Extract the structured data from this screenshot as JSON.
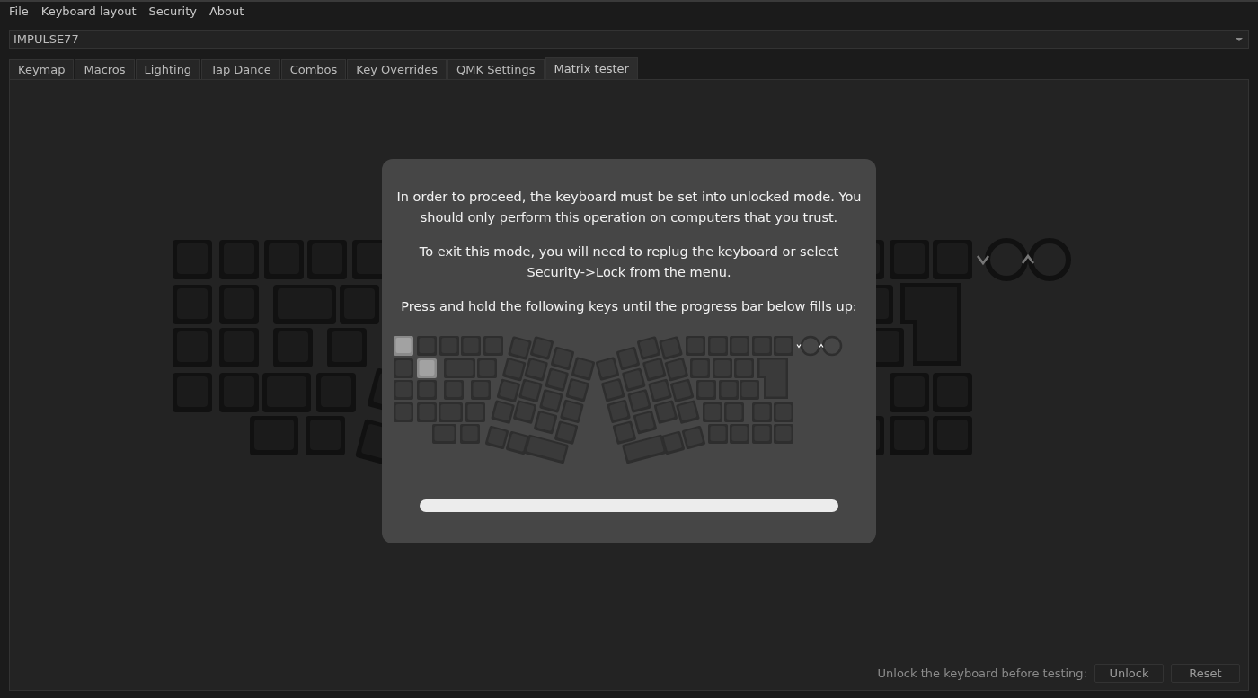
{
  "menu": [
    "File",
    "Keyboard layout",
    "Security",
    "About"
  ],
  "device_select": {
    "value": "IMPULSE77"
  },
  "tabs": [
    {
      "label": "Keymap",
      "selected": false
    },
    {
      "label": "Macros",
      "selected": false
    },
    {
      "label": "Lighting",
      "selected": false
    },
    {
      "label": "Tap Dance",
      "selected": false
    },
    {
      "label": "Combos",
      "selected": false
    },
    {
      "label": "Key Overrides",
      "selected": false
    },
    {
      "label": "QMK Settings",
      "selected": false
    },
    {
      "label": "Matrix tester",
      "selected": true
    }
  ],
  "dialog": {
    "paragraphs": [
      "In order to proceed, the keyboard must be set into unlocked mode. You should only perform this operation on computers that you trust.",
      "To exit this mode, you will need to replug the keyboard or select Security->Lock from the menu.",
      "Press and hold the following keys until the progress bar below fills up:"
    ],
    "keyboard": {
      "keys": [
        {
          "highlighted": true
        },
        {
          "highlighted": false
        },
        {
          "highlighted": false
        },
        {
          "highlighted": false
        },
        {
          "highlighted": false
        },
        {
          "highlighted": false
        },
        {
          "highlighted": true
        },
        {
          "highlighted": false
        },
        {
          "highlighted": false
        },
        {
          "highlighted": false
        },
        {
          "highlighted": false
        },
        {
          "highlighted": false
        },
        {
          "highlighted": false
        },
        {
          "highlighted": false
        },
        {
          "highlighted": false
        },
        {
          "highlighted": false
        },
        {
          "highlighted": false
        },
        {
          "highlighted": false
        },
        {
          "highlighted": false
        },
        {
          "highlighted": false
        },
        {
          "highlighted": false
        },
        {
          "highlighted": false
        },
        {
          "highlighted": false
        },
        {
          "highlighted": false
        },
        {
          "highlighted": false
        },
        {
          "highlighted": false
        },
        {
          "highlighted": false
        },
        {
          "highlighted": false
        },
        {
          "highlighted": false
        },
        {
          "highlighted": false
        },
        {
          "highlighted": false
        },
        {
          "highlighted": false
        },
        {
          "highlighted": false
        },
        {
          "highlighted": false
        },
        {
          "highlighted": false
        },
        {
          "highlighted": false
        },
        {
          "highlighted": false
        },
        {
          "highlighted": false
        },
        {
          "highlighted": false
        },
        {
          "highlighted": false
        },
        {
          "highlighted": false
        },
        {
          "highlighted": false
        },
        {
          "highlighted": false
        },
        {
          "highlighted": false
        },
        {
          "highlighted": false
        },
        {
          "highlighted": false
        },
        {
          "highlighted": false
        },
        {
          "highlighted": false
        },
        {
          "highlighted": false
        },
        {
          "highlighted": false
        },
        {
          "highlighted": false
        },
        {
          "highlighted": false
        },
        {
          "highlighted": false
        },
        {
          "highlighted": false
        },
        {
          "highlighted": false
        },
        {
          "highlighted": false
        },
        {
          "highlighted": false
        },
        {
          "highlighted": false
        },
        {
          "highlighted": false
        },
        {
          "highlighted": false
        },
        {
          "highlighted": false
        },
        {
          "highlighted": false
        },
        {
          "highlighted": false
        },
        {
          "highlighted": false
        },
        {
          "highlighted": false
        },
        {
          "highlighted": false
        },
        {
          "highlighted": false
        },
        {
          "highlighted": false
        },
        {
          "highlighted": false
        },
        {
          "highlighted": false
        },
        {
          "highlighted": false
        },
        {
          "highlighted": false
        },
        {
          "highlighted": false
        },
        {
          "highlighted": false
        },
        {
          "highlighted": false
        },
        {
          "highlighted": false
        },
        {
          "highlighted": false
        }
      ]
    },
    "progress": {
      "level": 0
    }
  },
  "footer": {
    "label": "Unlock the keyboard before testing:",
    "buttons": [
      "Unlock",
      "Reset"
    ]
  }
}
